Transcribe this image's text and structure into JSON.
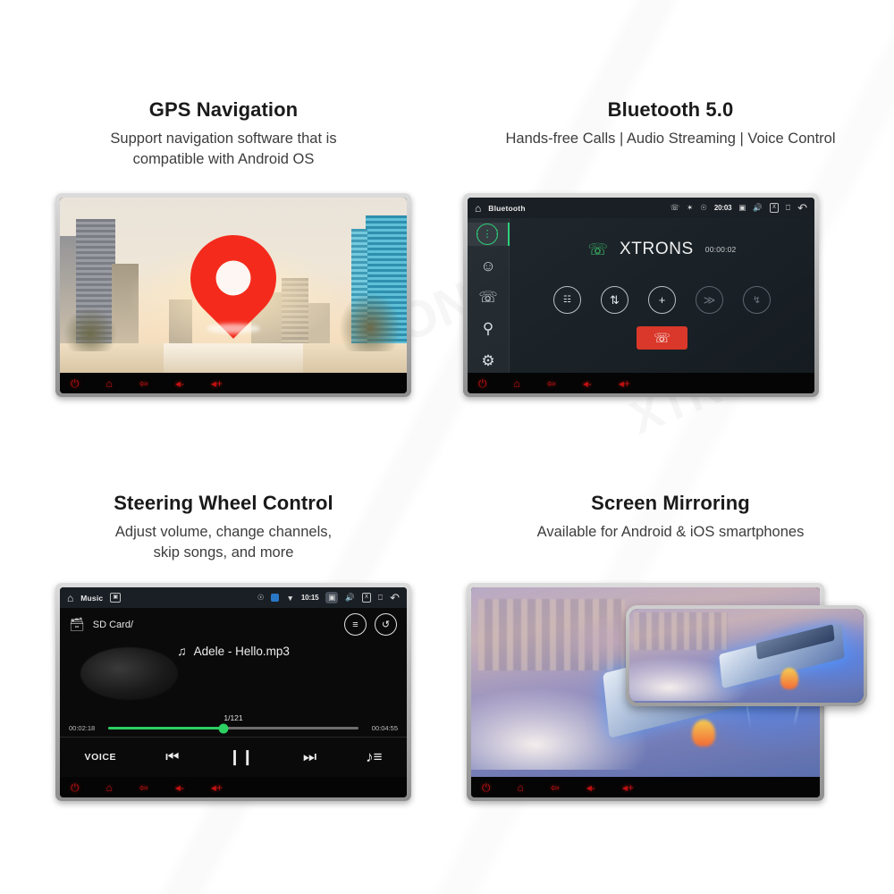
{
  "page": {
    "background": "#ffffff",
    "watermark_text": "XTRONS",
    "accent_red": "#c41010",
    "accent_green": "#2ccf62",
    "pin_color": "#f42b1c"
  },
  "features": [
    {
      "id": "gps-navigation",
      "title": "GPS Navigation",
      "subtitle": "Support navigation software that is\ncompatible with Android OS",
      "screen": {
        "kind": "gps-map",
        "pin_icon": "map-pin-icon"
      },
      "hardware_buttons": [
        "power-icon",
        "home-icon",
        "back-icon",
        "volume-down-icon",
        "volume-up-icon"
      ]
    },
    {
      "id": "bluetooth",
      "title": "Bluetooth 5.0",
      "subtitle": "Hands-free Calls | Audio Streaming | Voice Control",
      "screen": {
        "kind": "bluetooth-call",
        "status_bar": {
          "home_icon": "home-icon",
          "title": "Bluetooth",
          "icons": [
            "call-icon",
            "bluetooth-icon",
            "location-icon"
          ],
          "clock": "20:03",
          "right_icons": [
            "camera-icon",
            "volume-icon",
            "close-icon",
            "recents-icon",
            "back-icon"
          ]
        },
        "sidebar": [
          {
            "name": "dialpad-icon",
            "glyph": "∷",
            "active": true
          },
          {
            "name": "contacts-icon",
            "glyph": "♟",
            "active": false
          },
          {
            "name": "call-history-icon",
            "glyph": "✆",
            "active": false
          },
          {
            "name": "search-icon",
            "glyph": "⌕",
            "active": false
          },
          {
            "name": "settings-icon",
            "glyph": "⚙",
            "active": false
          }
        ],
        "caller": {
          "name": "XTRONS",
          "duration": "00:00:02",
          "ring_icon": "ringing-phone-icon"
        },
        "call_controls": [
          {
            "name": "keypad-button",
            "glyph": "∷",
            "dim": false
          },
          {
            "name": "transfer-audio-button",
            "glyph": "⇅",
            "dim": false
          },
          {
            "name": "add-call-button",
            "glyph": "+",
            "dim": false
          },
          {
            "name": "forward-call-button",
            "glyph": "≫",
            "dim": true
          },
          {
            "name": "swap-call-button",
            "glyph": "↰",
            "dim": true
          }
        ],
        "hangup": {
          "name": "hang-up-button",
          "glyph": "✆",
          "color": "#d9382a"
        }
      },
      "hardware_buttons": [
        "power-icon",
        "home-icon",
        "back-icon",
        "volume-down-icon",
        "volume-up-icon"
      ]
    },
    {
      "id": "steering-wheel-control",
      "title": "Steering Wheel Control",
      "subtitle": "Adjust volume, change channels,\nskip songs, and more",
      "screen": {
        "kind": "music-player",
        "status_bar": {
          "home_icon": "home-icon",
          "title": "Music",
          "icons": [
            "picture-icon",
            "location-icon",
            "app-badge-icon",
            "wifi-icon"
          ],
          "clock": "10:15",
          "right_icons": [
            "camera-icon",
            "volume-icon",
            "close-icon",
            "recents-icon",
            "back-icon"
          ]
        },
        "path_label": "SD Card/",
        "path_icon": "sd-card-icon",
        "right_buttons": [
          {
            "name": "equalizer-button",
            "glyph": "≡"
          },
          {
            "name": "repeat-button",
            "glyph": "↻"
          }
        ],
        "now_playing": "Adele - Hello.mp3",
        "note_icon": "music-note-icon",
        "track_counter": "1/121",
        "elapsed": "00:02:18",
        "total": "00:04:55",
        "progress_percent": 46,
        "transport": [
          {
            "name": "voice-button",
            "label": "VOICE",
            "glyph": ""
          },
          {
            "name": "previous-button",
            "label": "",
            "glyph": "⏮"
          },
          {
            "name": "pause-button",
            "label": "",
            "glyph": "❙ ❙"
          },
          {
            "name": "next-button",
            "label": "",
            "glyph": "⏭"
          },
          {
            "name": "playlist-button",
            "label": "",
            "glyph": "♪≡"
          }
        ]
      },
      "hardware_buttons": [
        "power-icon",
        "home-icon",
        "back-icon",
        "volume-down-icon",
        "volume-up-icon"
      ]
    },
    {
      "id": "screen-mirroring",
      "title": "Screen Mirroring",
      "subtitle": "Available for Android & iOS smartphones",
      "screen": {
        "kind": "mirroring",
        "phone_label": "mirrored-smartphone"
      },
      "hardware_buttons": [
        "power-icon",
        "home-icon",
        "back-icon",
        "volume-down-icon",
        "volume-up-icon"
      ]
    }
  ],
  "hardware_glyphs": {
    "power-icon": "⏻",
    "home-icon": "⌂",
    "back-icon": "↶",
    "volume-down-icon": "◂-",
    "volume-up-icon": "◂+"
  }
}
